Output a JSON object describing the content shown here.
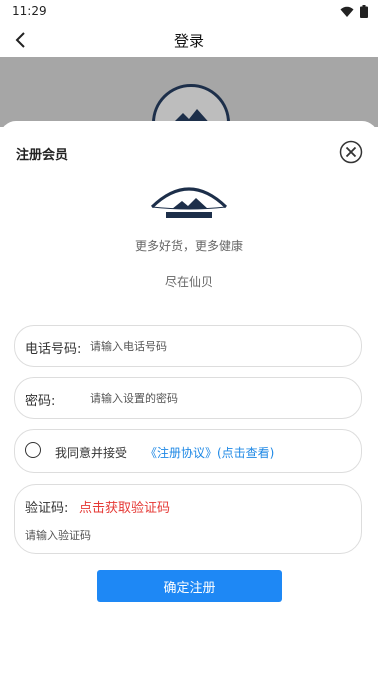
{
  "status_bar": {
    "time": "11:29",
    "icons": [
      "wifi-icon",
      "battery-icon"
    ]
  },
  "app_bar": {
    "title": "登录",
    "back_icon": "chevron-left-icon"
  },
  "sheet": {
    "title": "注册会员",
    "close_icon": "close-circle-icon",
    "logo_icon": "xianbei-logo",
    "slogan_line1": "更多好货，更多健康",
    "slogan_line2": "尽在仙贝",
    "phone": {
      "label": "电话号码:",
      "placeholder": "请输入电话号码",
      "value": ""
    },
    "password": {
      "label": "密码:",
      "placeholder": "请输入设置的密码",
      "value": ""
    },
    "agree": {
      "text": "我同意并接受",
      "link": "《注册协议》(点击查看)",
      "checked": false
    },
    "code": {
      "label": "验证码:",
      "get_code": "点击获取验证码",
      "placeholder": "请输入验证码",
      "value": ""
    },
    "submit_label": "确定注册"
  },
  "colors": {
    "accent": "#1e88f5",
    "link": "#1e88e5",
    "get_code": "#e53935",
    "overlay_banner": "#a6a6a6"
  }
}
